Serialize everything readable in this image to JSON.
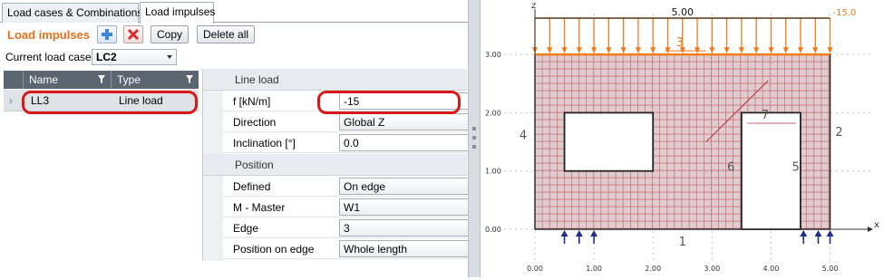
{
  "tabs": [
    {
      "label": "Load cases & Combinations",
      "active": false
    },
    {
      "label": "Load impulses",
      "active": true
    }
  ],
  "toolbar": {
    "title": "Load impulses",
    "copy_label": "Copy",
    "delete_all_label": "Delete all",
    "add_icon": "add-icon",
    "delete_icon": "delete-icon"
  },
  "load_case": {
    "label": "Current load case",
    "value": "LC2"
  },
  "table": {
    "columns": [
      "Name",
      "Type"
    ],
    "rows": [
      {
        "name": "LL3",
        "type": "Line load"
      }
    ]
  },
  "properties": {
    "line_load": {
      "header": "Line load",
      "f_label": "f [kN/m]",
      "f_value": "-15",
      "direction_label": "Direction",
      "direction_value": "Global Z",
      "inclination_label": "Inclination [°]",
      "inclination_value": "0.0"
    },
    "position": {
      "header": "Position",
      "defined_label": "Defined",
      "defined_value": "On edge",
      "master_label": "M - Master",
      "master_value": "W1",
      "edge_label": "Edge",
      "edge_value": "3",
      "pos_edge_label": "Position on edge",
      "pos_edge_value": "Whole length"
    }
  },
  "drawing": {
    "top_dim": "5.00",
    "load_value": "-15.0",
    "axis_z": "z",
    "axis_x": "x",
    "x_ticks": [
      "0.00",
      "1.00",
      "2.00",
      "3.00",
      "4.00",
      "5.00"
    ],
    "y_ticks": [
      "0.00",
      "1.00",
      "2.00",
      "3.00"
    ],
    "edge_labels": {
      "e1": "1",
      "e2": "2",
      "e3": "3",
      "e4": "4",
      "e5": "5",
      "e6": "6",
      "e7": "7"
    },
    "colors": {
      "load": "#f07c1e",
      "wall": "#c9a3a8",
      "mesh": "#b3303b",
      "highlight": "#d81919"
    }
  }
}
